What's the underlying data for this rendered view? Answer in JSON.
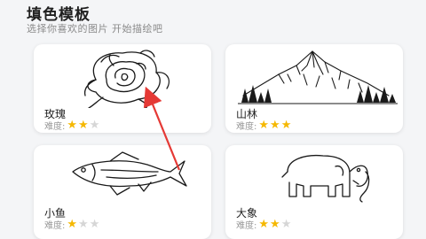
{
  "header": {
    "title": "填色模板",
    "subtitle": "选择你喜欢的图片 开始描绘吧"
  },
  "difficulty_label": "难度:",
  "colors": {
    "star_on": "#f5b800",
    "star_off": "#d6d6d6",
    "arrow": "#e53935"
  },
  "templates": [
    {
      "name": "玫瑰",
      "difficulty": 2,
      "max": 3,
      "icon": "rose-drawing"
    },
    {
      "name": "山林",
      "difficulty": 3,
      "max": 3,
      "icon": "mountain-forest-drawing"
    },
    {
      "name": "小鱼",
      "difficulty": 1,
      "max": 3,
      "icon": "fish-drawing"
    },
    {
      "name": "大象",
      "difficulty": 2,
      "max": 3,
      "icon": "elephant-drawing"
    }
  ]
}
